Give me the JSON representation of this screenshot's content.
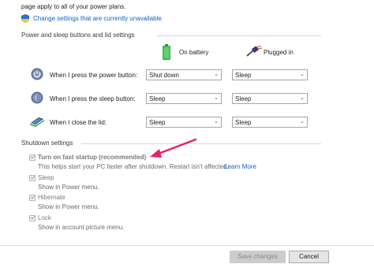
{
  "header": {
    "intro_text": "page apply to all of your power plans.",
    "change_settings_link": "Change settings that are currently unavailable"
  },
  "buttons_section": {
    "title": "Power and sleep buttons and lid settings",
    "column_on_battery": "On battery",
    "column_plugged_in": "Plugged in",
    "rows": [
      {
        "label": "When I press the power button:",
        "on_battery": "Shut down",
        "plugged_in": "Sleep"
      },
      {
        "label": "When I press the sleep button:",
        "on_battery": "Sleep",
        "plugged_in": "Sleep"
      },
      {
        "label": "When I close the lid:",
        "on_battery": "Sleep",
        "plugged_in": "Sleep"
      }
    ]
  },
  "shutdown_section": {
    "title": "Shutdown settings",
    "options": [
      {
        "label": "Turn on fast startup (recommended)",
        "description": "This helps start your PC faster after shutdown. Restart isn't affected.",
        "link": "Learn More",
        "checked": true
      },
      {
        "label": "Sleep",
        "description": "Show in Power menu.",
        "checked": true
      },
      {
        "label": "Hibernate",
        "description": "Show in Power menu.",
        "checked": true
      },
      {
        "label": "Lock",
        "description": "Show in account picture menu.",
        "checked": true
      }
    ]
  },
  "footer": {
    "save_label": "Save changes",
    "cancel_label": "Cancel"
  },
  "colors": {
    "link": "#0d5fc6",
    "annotation_arrow": "#e8216a",
    "battery_green": "#39b54a"
  },
  "icons": [
    "shield-icon",
    "battery-icon",
    "plug-icon",
    "power-button-icon",
    "sleep-button-icon",
    "laptop-lid-icon",
    "checkbox-icon",
    "annotation-arrow"
  ]
}
